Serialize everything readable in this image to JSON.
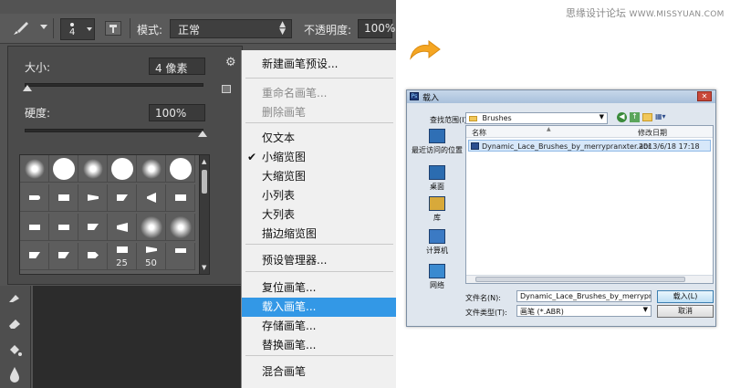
{
  "watermark": {
    "site": "思缘设计论坛",
    "url": "WWW.MISSYUAN.COM"
  },
  "options_bar": {
    "brush_size": "4",
    "mode_label": "模式:",
    "mode_value": "正常",
    "opacity_label": "不透明度:",
    "opacity_value": "100%"
  },
  "brush_panel": {
    "size_label": "大小:",
    "size_value": "4 像素",
    "hardness_label": "硬度:",
    "hardness_value": "100%",
    "thumb_numbers": [
      "25",
      "50"
    ]
  },
  "brush_menu": {
    "items": [
      {
        "label": "新建画笔预设...",
        "state": "normal"
      },
      {
        "label": "重命名画笔...",
        "state": "disabled"
      },
      {
        "label": "删除画笔",
        "state": "disabled"
      },
      {
        "label": "仅文本",
        "state": "normal"
      },
      {
        "label": "小缩览图",
        "state": "checked"
      },
      {
        "label": "大缩览图",
        "state": "normal"
      },
      {
        "label": "小列表",
        "state": "normal"
      },
      {
        "label": "大列表",
        "state": "normal"
      },
      {
        "label": "描边缩览图",
        "state": "normal"
      },
      {
        "label": "预设管理器...",
        "state": "normal"
      },
      {
        "label": "复位画笔...",
        "state": "normal"
      },
      {
        "label": "载入画笔...",
        "state": "highlighted"
      },
      {
        "label": "存储画笔...",
        "state": "normal"
      },
      {
        "label": "替换画笔...",
        "state": "normal"
      },
      {
        "label": "混合画笔",
        "state": "normal"
      }
    ]
  },
  "load_dialog": {
    "title": "载入",
    "lookin_label": "查找范围(I):",
    "lookin_value": "Brushes",
    "places": [
      {
        "label": "最近访问的位置",
        "icon": "recent-places-icon"
      },
      {
        "label": "桌面",
        "icon": "desktop-icon"
      },
      {
        "label": "库",
        "icon": "libraries-icon"
      },
      {
        "label": "计算机",
        "icon": "computer-icon"
      },
      {
        "label": "网络",
        "icon": "network-icon"
      }
    ],
    "columns": {
      "name": "名称",
      "modified": "修改日期"
    },
    "file": {
      "name": "Dynamic_Lace_Brushes_by_merrypranxter.abr",
      "modified": "2013/6/18 17:18"
    },
    "filename_label": "文件名(N):",
    "filename_value": "Dynamic_Lace_Brushes_by_merrypranxter.abr",
    "filetype_label": "文件类型(T):",
    "filetype_value": "画笔 (*.ABR)",
    "load_button": "载入(L)",
    "cancel_button": "取消"
  },
  "colors": {
    "ps_bg": "#535353",
    "menu_highlight": "#3398e6",
    "arrow": "#f5a623"
  }
}
